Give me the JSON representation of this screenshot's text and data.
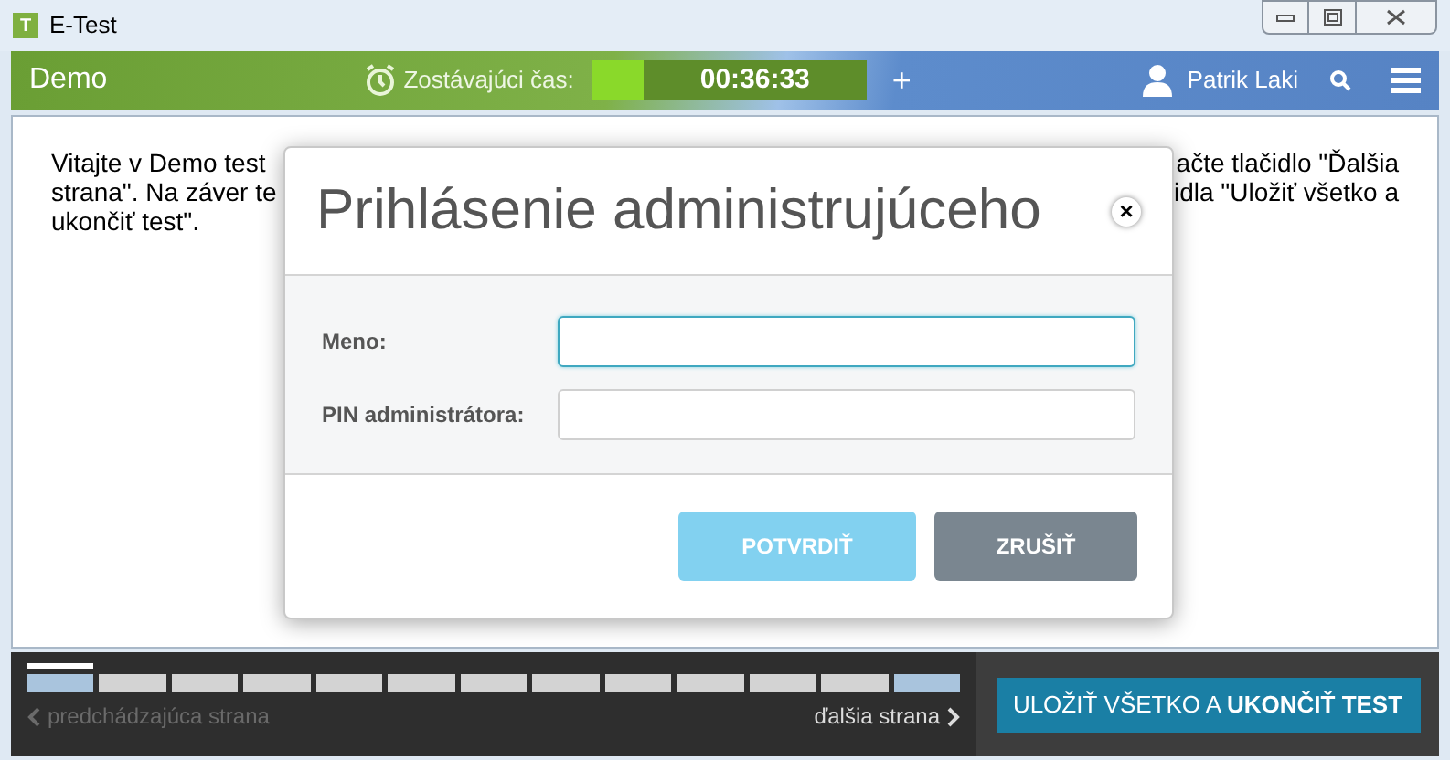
{
  "window": {
    "title": "E-Test",
    "app_icon": "T"
  },
  "header": {
    "test_name": "Demo",
    "timer_label": "Zostávajúci čas:",
    "timer": "00:36:33",
    "plus": "+",
    "user": "Patrik Laki"
  },
  "intro_visible": {
    "left": [
      "Vitajte v Demo test",
      "strana\". Na záver te",
      "ukončiť test\"."
    ],
    "right": [
      "ačte tlačidlo \"Ďalšia",
      "idla \"Uložiť všetko a"
    ]
  },
  "dialog": {
    "title": "Prihlásenie administrujúceho",
    "close": "×",
    "fields": [
      {
        "label": "Meno:",
        "focused": true
      },
      {
        "label": "PIN administrátora:",
        "focused": false
      }
    ],
    "buttons": [
      {
        "label": "POTVRDIŤ",
        "disabled": true
      },
      {
        "label": "ZRUŠIŤ",
        "disabled": false
      }
    ]
  },
  "footer": {
    "pages": [
      {
        "visited": true,
        "current": true
      },
      {
        "visited": false,
        "current": false
      },
      {
        "visited": false,
        "current": false
      },
      {
        "visited": false,
        "current": false
      },
      {
        "visited": false,
        "current": false
      },
      {
        "visited": false,
        "current": false
      },
      {
        "visited": false,
        "current": false
      },
      {
        "visited": false,
        "current": false
      },
      {
        "visited": false,
        "current": false
      },
      {
        "visited": false,
        "current": false
      },
      {
        "visited": false,
        "current": false
      },
      {
        "visited": false,
        "current": false
      },
      {
        "visited": true,
        "current": false
      }
    ],
    "prev": {
      "label": "predchádzajúca strana",
      "disabled": true
    },
    "next": {
      "label": "ďalšia strana",
      "disabled": false
    },
    "finish": "ULOŽIŤ VŠETKO A **UKONČIŤ TEST**"
  }
}
